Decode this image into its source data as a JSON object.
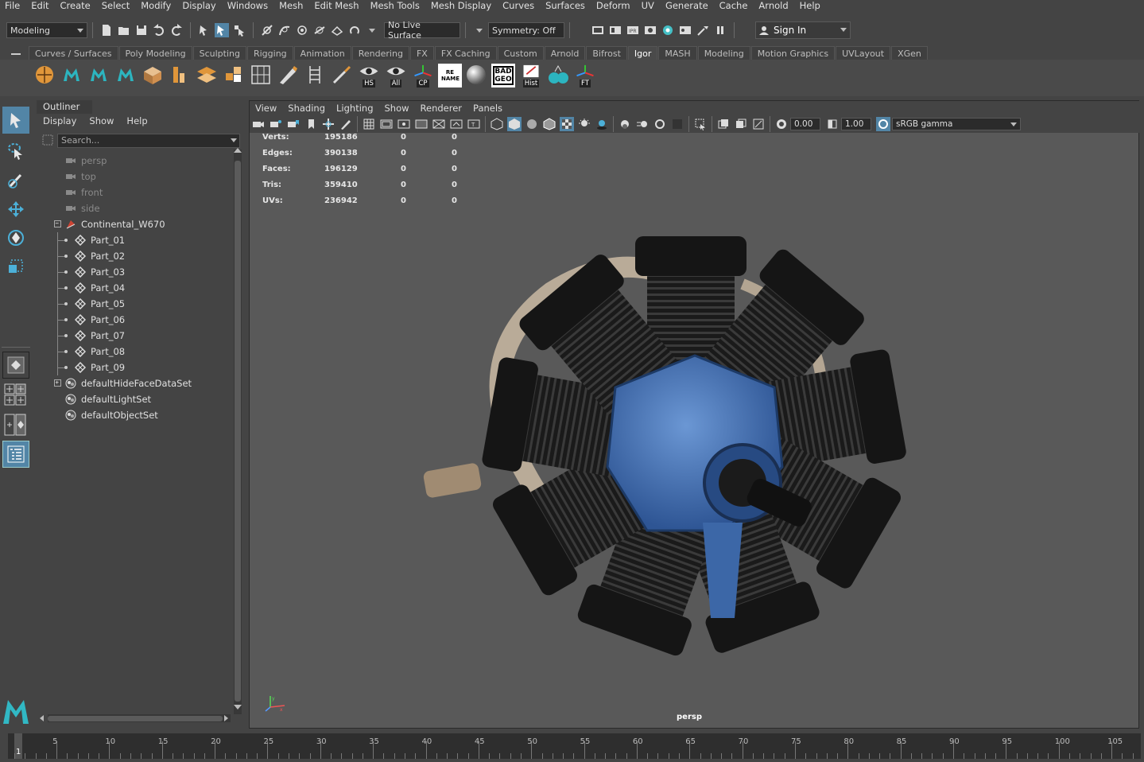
{
  "menubar": [
    "File",
    "Edit",
    "Create",
    "Select",
    "Modify",
    "Display",
    "Windows",
    "Mesh",
    "Edit Mesh",
    "Mesh Tools",
    "Mesh Display",
    "Curves",
    "Surfaces",
    "Deform",
    "UV",
    "Generate",
    "Cache",
    "Arnold",
    "Help"
  ],
  "statusline": {
    "mode": "Modeling",
    "live_surface": "No Live Surface",
    "symmetry": "Symmetry: Off",
    "sign_in": "Sign In"
  },
  "shelf_tabs": [
    "Curves / Surfaces",
    "Poly Modeling",
    "Sculpting",
    "Rigging",
    "Animation",
    "Rendering",
    "FX",
    "FX Caching",
    "Custom",
    "Arnold",
    "Bifrost",
    "Igor",
    "MASH",
    "Modeling",
    "Motion Graphics",
    "UVLayout",
    "XGen"
  ],
  "shelf_active": "Igor",
  "shelf_labels": {
    "hs": "HS",
    "all": "All",
    "cp": "CP",
    "rename": "RE NAME",
    "badgeo": "BAD GEO",
    "hist": "Hist",
    "ft": "FT"
  },
  "outliner": {
    "tab": "Outliner",
    "menu": [
      "Display",
      "Show",
      "Help"
    ],
    "search_placeholder": "Search...",
    "cameras": [
      "persp",
      "top",
      "front",
      "side"
    ],
    "group": "Continental_W670",
    "parts": [
      "Part_01",
      "Part_02",
      "Part_03",
      "Part_04",
      "Part_05",
      "Part_06",
      "Part_07",
      "Part_08",
      "Part_09"
    ],
    "sets": [
      "defaultHideFaceDataSet",
      "defaultLightSet",
      "defaultObjectSet"
    ]
  },
  "viewport": {
    "menu": [
      "View",
      "Shading",
      "Lighting",
      "Show",
      "Renderer",
      "Panels"
    ],
    "exposure": "0.00",
    "gamma": "1.00",
    "color_space": "sRGB gamma",
    "camera": "persp",
    "hud": [
      {
        "label": "Verts:",
        "v1": "195186",
        "v2": "0",
        "v3": "0"
      },
      {
        "label": "Edges:",
        "v1": "390138",
        "v2": "0",
        "v3": "0"
      },
      {
        "label": "Faces:",
        "v1": "196129",
        "v2": "0",
        "v3": "0"
      },
      {
        "label": "Tris:",
        "v1": "359410",
        "v2": "0",
        "v3": "0"
      },
      {
        "label": "UVs:",
        "v1": "236942",
        "v2": "0",
        "v3": "0"
      }
    ]
  },
  "timeline": {
    "current": "1",
    "ticks": [
      "5",
      "10",
      "15",
      "20",
      "25",
      "30",
      "35",
      "40",
      "45",
      "50",
      "55",
      "60",
      "65",
      "70",
      "75",
      "80",
      "85",
      "90",
      "95",
      "100",
      "105"
    ]
  },
  "colors": {
    "accent": "#5285a6",
    "engine_blue": "#4a78b8",
    "bg": "#444444",
    "viewport": "#595959"
  }
}
